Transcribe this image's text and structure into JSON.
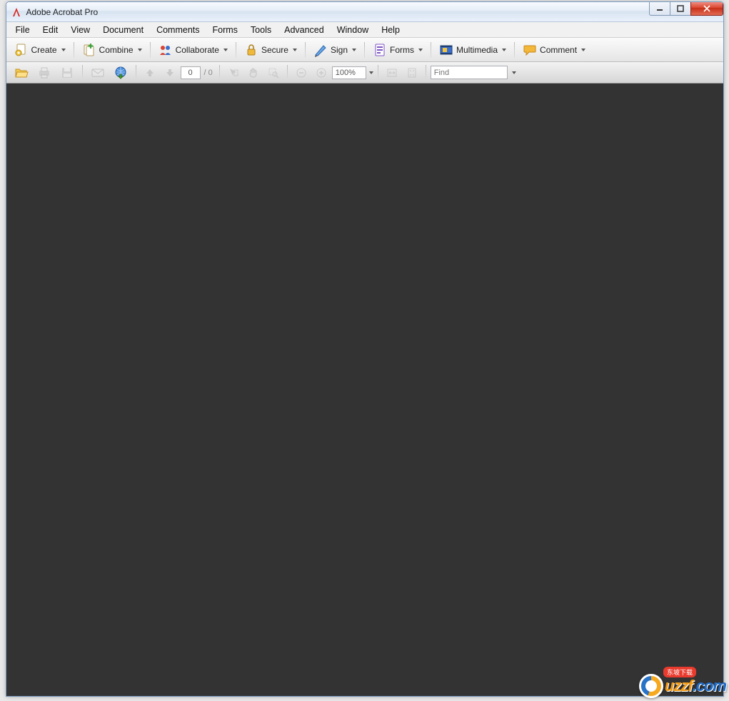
{
  "titlebar": {
    "title": "Adobe Acrobat Pro"
  },
  "menubar": {
    "items": [
      "File",
      "Edit",
      "View",
      "Document",
      "Comments",
      "Forms",
      "Tools",
      "Advanced",
      "Window",
      "Help"
    ]
  },
  "toolbar1": {
    "create": "Create",
    "combine": "Combine",
    "collaborate": "Collaborate",
    "secure": "Secure",
    "sign": "Sign",
    "forms": "Forms",
    "multimedia": "Multimedia",
    "comment": "Comment"
  },
  "toolbar2": {
    "page_current": "0",
    "page_total": "/ 0",
    "zoom": "100%",
    "find_placeholder": "Find"
  },
  "watermark": {
    "tag": "东坡下载",
    "text1": "uzzf",
    "text2": ".com"
  }
}
